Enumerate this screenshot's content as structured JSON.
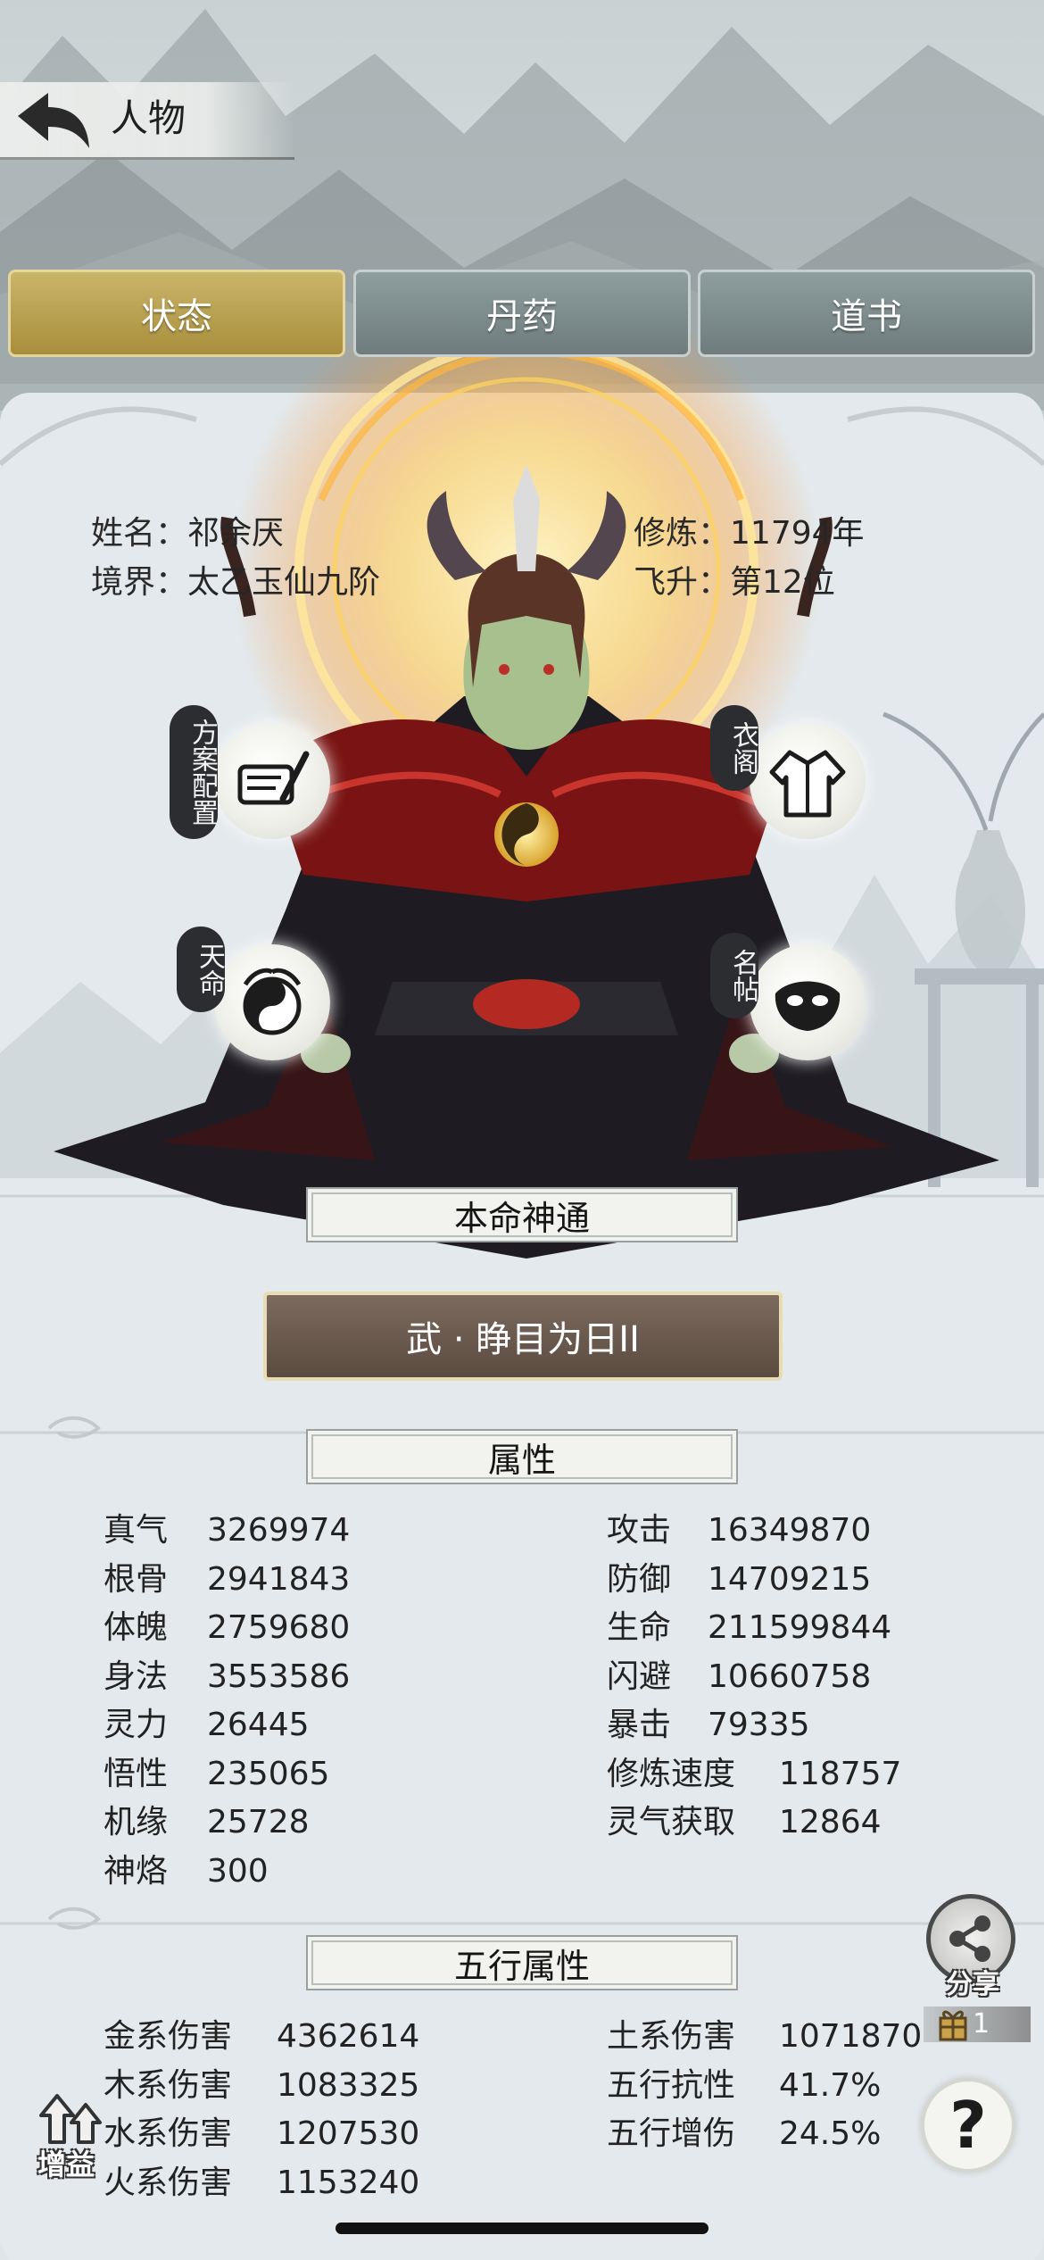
{
  "header": {
    "title": "人物"
  },
  "tabs": [
    {
      "label": "状态",
      "active": true
    },
    {
      "label": "丹药",
      "active": false
    },
    {
      "label": "道书",
      "active": false
    }
  ],
  "profile": {
    "name_label": "姓名：",
    "name": "祁余厌",
    "realm_label": "境界：",
    "realm": "太乙玉仙九阶",
    "cultivation_label": "修炼：",
    "cultivation": "11794年",
    "ascension_label": "飞升：",
    "ascension": "第12位"
  },
  "menu": {
    "plan_config": "方案配置",
    "wardrobe": "衣阁",
    "destiny": "天命",
    "card": "名帖"
  },
  "skill": {
    "header": "本命神通",
    "name": "武 · 睁目为日II"
  },
  "attributes": {
    "header": "属性",
    "left": [
      {
        "label": "真气",
        "value": "3269974"
      },
      {
        "label": "根骨",
        "value": "2941843"
      },
      {
        "label": "体魄",
        "value": "2759680"
      },
      {
        "label": "身法",
        "value": "3553586"
      },
      {
        "label": "灵力",
        "value": "26445"
      },
      {
        "label": "悟性",
        "value": "235065"
      },
      {
        "label": "机缘",
        "value": "25728"
      },
      {
        "label": "神烙",
        "value": "300"
      }
    ],
    "right": [
      {
        "label": "攻击",
        "value": "16349870"
      },
      {
        "label": "防御",
        "value": "14709215"
      },
      {
        "label": "生命",
        "value": "211599844"
      },
      {
        "label": "闪避",
        "value": "10660758"
      },
      {
        "label": "暴击",
        "value": "79335"
      },
      {
        "label": "修炼速度",
        "value": "118757"
      },
      {
        "label": "灵气获取",
        "value": "12864"
      }
    ]
  },
  "elements": {
    "header": "五行属性",
    "left": [
      {
        "label": "金系伤害",
        "value": "4362614"
      },
      {
        "label": "木系伤害",
        "value": "1083325"
      },
      {
        "label": "水系伤害",
        "value": "1207530"
      },
      {
        "label": "火系伤害",
        "value": "1153240"
      }
    ],
    "right": [
      {
        "label": "土系伤害",
        "value": "1071870"
      },
      {
        "label": "五行抗性",
        "value": "41.7%"
      },
      {
        "label": "五行增伤",
        "value": "24.5%"
      }
    ]
  },
  "side": {
    "share_label": "分享",
    "share_count": "1",
    "help": "?",
    "buff_label": "增益"
  },
  "icons": {
    "back": "back-arrow-icon",
    "plan": "scroll-brush-icon",
    "wardrobe": "robe-icon",
    "destiny": "yin-yang-icon",
    "card": "mask-icon",
    "share": "share-icon",
    "help": "question-icon",
    "buff": "buff-arrows-icon"
  }
}
